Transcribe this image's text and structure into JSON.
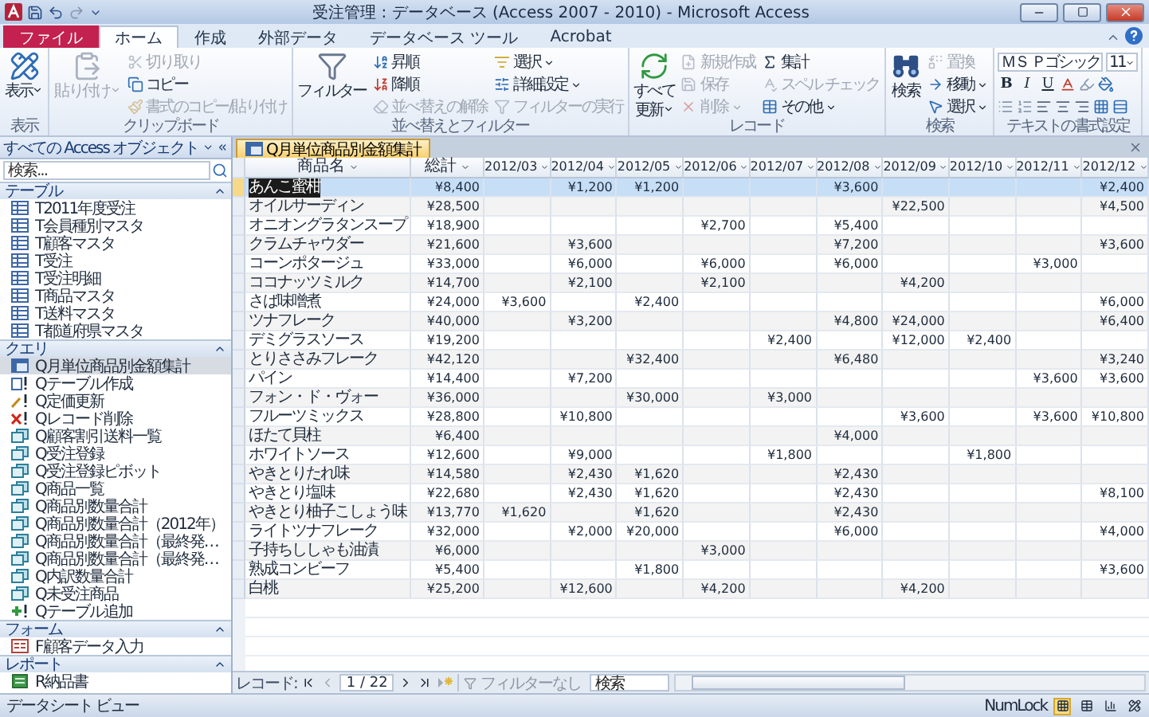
{
  "window": {
    "title": "受注管理 : データベース (Access 2007 - 2010) - Microsoft Access"
  },
  "ribbon_tabs": [
    {
      "label": "ファイル",
      "kind": "file",
      "selected": false
    },
    {
      "label": "ホーム",
      "kind": "tab",
      "selected": true
    },
    {
      "label": "作成",
      "kind": "tab",
      "selected": false
    },
    {
      "label": "外部データ",
      "kind": "tab",
      "selected": false
    },
    {
      "label": "データベース ツール",
      "kind": "tab",
      "selected": false
    },
    {
      "label": "Acrobat",
      "kind": "tab",
      "selected": false
    }
  ],
  "ribbon": {
    "groups": [
      {
        "label": "表示",
        "columns": [
          [
            {
              "label": "表示",
              "kind": "large",
              "disabled": false,
              "dropdown": true
            }
          ]
        ]
      },
      {
        "label": "クリップボード",
        "columns": [
          [
            {
              "label": "貼り付け",
              "kind": "large",
              "disabled": true,
              "dropdown": true
            }
          ],
          [
            {
              "label": "切り取り",
              "kind": "small",
              "disabled": true,
              "dropdown": false
            },
            {
              "label": "コピー",
              "kind": "small",
              "disabled": false,
              "dropdown": false
            },
            {
              "label": "書式のコピー/貼り付け",
              "kind": "small",
              "disabled": true,
              "dropdown": false
            }
          ]
        ]
      },
      {
        "label": "並べ替えとフィルター",
        "columns": [
          [
            {
              "label": "フィルター",
              "kind": "large",
              "disabled": false,
              "dropdown": false
            }
          ],
          [
            {
              "label": "昇順",
              "kind": "small",
              "disabled": false,
              "dropdown": false
            },
            {
              "label": "降順",
              "kind": "small",
              "disabled": false,
              "dropdown": false
            },
            {
              "label": "並べ替えの解除",
              "kind": "small",
              "disabled": true,
              "dropdown": false
            }
          ],
          [
            {
              "label": "選択",
              "kind": "small",
              "disabled": false,
              "dropdown": true
            },
            {
              "label": "詳細設定",
              "kind": "small",
              "disabled": false,
              "dropdown": true
            },
            {
              "label": "フィルターの実行",
              "kind": "small",
              "disabled": true,
              "dropdown": false
            }
          ]
        ]
      },
      {
        "label": "レコード",
        "columns": [
          [
            {
              "label": "すべて",
              "label_2": "更新",
              "kind": "large",
              "disabled": false,
              "dropdown": true
            }
          ],
          [
            {
              "label": "新規作成",
              "kind": "small",
              "disabled": true,
              "dropdown": false
            },
            {
              "label": "保存",
              "kind": "small",
              "disabled": true,
              "dropdown": false
            },
            {
              "label": "削除",
              "kind": "small",
              "disabled": true,
              "dropdown": true
            }
          ],
          [
            {
              "label": "集計",
              "kind": "small",
              "disabled": false,
              "dropdown": false
            },
            {
              "label": "スペル チェック",
              "kind": "small",
              "disabled": true,
              "dropdown": false
            },
            {
              "label": "その他",
              "kind": "small",
              "disabled": false,
              "dropdown": true
            }
          ]
        ]
      },
      {
        "label": "検索",
        "columns": [
          [
            {
              "label": "検索",
              "kind": "large",
              "disabled": false,
              "dropdown": false
            }
          ],
          [
            {
              "label": "置換",
              "kind": "small",
              "disabled": true,
              "dropdown": false
            },
            {
              "label": "移動",
              "kind": "small",
              "disabled": false,
              "dropdown": true
            },
            {
              "label": "選択",
              "kind": "small",
              "disabled": false,
              "dropdown": true
            }
          ]
        ]
      }
    ],
    "text_format": {
      "label": "テキストの書式設定",
      "font": "ＭＳ Ｐゴシック",
      "size": "11",
      "styles": [
        "B",
        "I",
        "U"
      ]
    }
  },
  "nav": {
    "title": "すべての Access オブジェクト",
    "search": {
      "placeholder": "検索..."
    },
    "sections": [
      {
        "label": "テーブル",
        "expanded": true,
        "items": [
          {
            "label": "T2011年度受注",
            "kind": "table",
            "selected": false
          },
          {
            "label": "T会員種別マスタ",
            "kind": "table",
            "selected": false
          },
          {
            "label": "T顧客マスタ",
            "kind": "table",
            "selected": false
          },
          {
            "label": "T受注",
            "kind": "table",
            "selected": false
          },
          {
            "label": "T受注明細",
            "kind": "table",
            "selected": false
          },
          {
            "label": "T商品マスタ",
            "kind": "table",
            "selected": false
          },
          {
            "label": "T送料マスタ",
            "kind": "table",
            "selected": false
          },
          {
            "label": "T都道府県マスタ",
            "kind": "table",
            "selected": false
          }
        ]
      },
      {
        "label": "クエリ",
        "expanded": true,
        "items": [
          {
            "label": "Q月単位商品別金額集計",
            "kind": "crosstab",
            "selected": true
          },
          {
            "label": "Qテーブル作成",
            "kind": "make",
            "selected": false
          },
          {
            "label": "Q定価更新",
            "kind": "update",
            "selected": false
          },
          {
            "label": "Qレコード削除",
            "kind": "delete",
            "selected": false
          },
          {
            "label": "Q顧客割引送料一覧",
            "kind": "select",
            "selected": false
          },
          {
            "label": "Q受注登録",
            "kind": "select",
            "selected": false
          },
          {
            "label": "Q受注登録ピボット",
            "kind": "select",
            "selected": false
          },
          {
            "label": "Q商品一覧",
            "kind": "select",
            "selected": false
          },
          {
            "label": "Q商品別数量合計",
            "kind": "select",
            "selected": false
          },
          {
            "label": "Q商品別数量合計（2012年）",
            "kind": "select",
            "selected": false
          },
          {
            "label": "Q商品別数量合計（最終発…",
            "kind": "select",
            "selected": false
          },
          {
            "label": "Q商品別数量合計（最終発…",
            "kind": "select",
            "selected": false
          },
          {
            "label": "Q内訳数量合計",
            "kind": "select",
            "selected": false
          },
          {
            "label": "Q未受注商品",
            "kind": "select",
            "selected": false
          },
          {
            "label": "Qテーブル追加",
            "kind": "append",
            "selected": false
          }
        ]
      },
      {
        "label": "フォーム",
        "expanded": true,
        "items": [
          {
            "label": "F顧客データ入力",
            "kind": "form",
            "selected": false
          }
        ]
      },
      {
        "label": "レポート",
        "expanded": true,
        "items": [
          {
            "label": "R納品書",
            "kind": "report",
            "selected": false
          }
        ]
      }
    ]
  },
  "document": {
    "tab": "Q月単位商品別金額集計"
  },
  "table": {
    "columns": [
      {
        "label": "商品名",
        "kind": "text"
      },
      {
        "label": "総計",
        "kind": "number"
      },
      {
        "label": "2012/03",
        "kind": "number"
      },
      {
        "label": "2012/04",
        "kind": "number"
      },
      {
        "label": "2012/05",
        "kind": "number"
      },
      {
        "label": "2012/06",
        "kind": "number"
      },
      {
        "label": "2012/07",
        "kind": "number"
      },
      {
        "label": "2012/08",
        "kind": "number"
      },
      {
        "label": "2012/09",
        "kind": "number"
      },
      {
        "label": "2012/10",
        "kind": "number"
      },
      {
        "label": "2012/11",
        "kind": "number"
      },
      {
        "label": "2012/12",
        "kind": "number"
      }
    ],
    "rows": [
      {
        "name": "あんこ蜜柑",
        "total": "¥8,400",
        "months": {
          "1": "¥1,200",
          "2": "¥1,200",
          "5": "¥3,600",
          "9": "¥2,400"
        },
        "selected": true
      },
      {
        "name": "オイルサーディン",
        "total": "¥28,500",
        "months": {
          "6": "¥22,500",
          "9": "¥4,500"
        },
        "selected": false
      },
      {
        "name": "オニオングラタンスープ",
        "total": "¥18,900",
        "months": {
          "3": "¥2,700",
          "5": "¥5,400"
        },
        "selected": false
      },
      {
        "name": "クラムチャウダー",
        "total": "¥21,600",
        "months": {
          "1": "¥3,600",
          "5": "¥7,200",
          "9": "¥3,600"
        },
        "selected": false
      },
      {
        "name": "コーンポタージュ",
        "total": "¥33,000",
        "months": {
          "1": "¥6,000",
          "3": "¥6,000",
          "5": "¥6,000",
          "8": "¥3,000"
        },
        "selected": false
      },
      {
        "name": "ココナッツミルク",
        "total": "¥14,700",
        "months": {
          "1": "¥2,100",
          "3": "¥2,100",
          "6": "¥4,200"
        },
        "selected": false
      },
      {
        "name": "さば味噌煮",
        "total": "¥24,000",
        "months": {
          "0": "¥3,600",
          "2": "¥2,400",
          "9": "¥6,000"
        },
        "selected": false
      },
      {
        "name": "ツナフレーク",
        "total": "¥40,000",
        "months": {
          "1": "¥3,200",
          "5": "¥4,800",
          "6": "¥24,000",
          "9": "¥6,400"
        },
        "selected": false
      },
      {
        "name": "デミグラスソース",
        "total": "¥19,200",
        "months": {
          "4": "¥2,400",
          "6": "¥12,000",
          "7": "¥2,400"
        },
        "selected": false
      },
      {
        "name": "とりささみフレーク",
        "total": "¥42,120",
        "months": {
          "2": "¥32,400",
          "5": "¥6,480",
          "9": "¥3,240"
        },
        "selected": false
      },
      {
        "name": "パイン",
        "total": "¥14,400",
        "months": {
          "1": "¥7,200",
          "8": "¥3,600",
          "9": "¥3,600"
        },
        "selected": false
      },
      {
        "name": "フォン・ド・ヴォー",
        "total": "¥36,000",
        "months": {
          "2": "¥30,000",
          "4": "¥3,000"
        },
        "selected": false
      },
      {
        "name": "フルーツミックス",
        "total": "¥28,800",
        "months": {
          "1": "¥10,800",
          "6": "¥3,600",
          "8": "¥3,600",
          "9": "¥10,800"
        },
        "selected": false
      },
      {
        "name": "ほたて貝柱",
        "total": "¥6,400",
        "months": {
          "5": "¥4,000"
        },
        "selected": false
      },
      {
        "name": "ホワイトソース",
        "total": "¥12,600",
        "months": {
          "1": "¥9,000",
          "4": "¥1,800",
          "7": "¥1,800"
        },
        "selected": false
      },
      {
        "name": "やきとりたれ味",
        "total": "¥14,580",
        "months": {
          "1": "¥2,430",
          "2": "¥1,620",
          "5": "¥2,430"
        },
        "selected": false
      },
      {
        "name": "やきとり塩味",
        "total": "¥22,680",
        "months": {
          "1": "¥2,430",
          "2": "¥1,620",
          "5": "¥2,430",
          "9": "¥8,100"
        },
        "selected": false
      },
      {
        "name": "やきとり柚子こしょう味",
        "total": "¥13,770",
        "months": {
          "0": "¥1,620",
          "2": "¥1,620",
          "5": "¥2,430"
        },
        "selected": false
      },
      {
        "name": "ライトツナフレーク",
        "total": "¥32,000",
        "months": {
          "1": "¥2,000",
          "2": "¥20,000",
          "5": "¥6,000",
          "9": "¥4,000"
        },
        "selected": false
      },
      {
        "name": "子持ちししゃも油漬",
        "total": "¥6,000",
        "months": {
          "3": "¥3,000"
        },
        "selected": false
      },
      {
        "name": "熟成コンビーフ",
        "total": "¥5,400",
        "months": {
          "2": "¥1,800",
          "9": "¥3,600"
        },
        "selected": false
      },
      {
        "name": "白桃",
        "total": "¥25,200",
        "months": {
          "1": "¥12,600",
          "3": "¥4,200",
          "6": "¥4,200"
        },
        "selected": false
      }
    ]
  },
  "record_nav": {
    "label": "レコード:",
    "position": "1 / 22",
    "filter": "フィルターなし",
    "search": {
      "placeholder": "検索"
    }
  },
  "status_bar": {
    "view": "データシート ビュー",
    "numlock": "NumLock"
  }
}
